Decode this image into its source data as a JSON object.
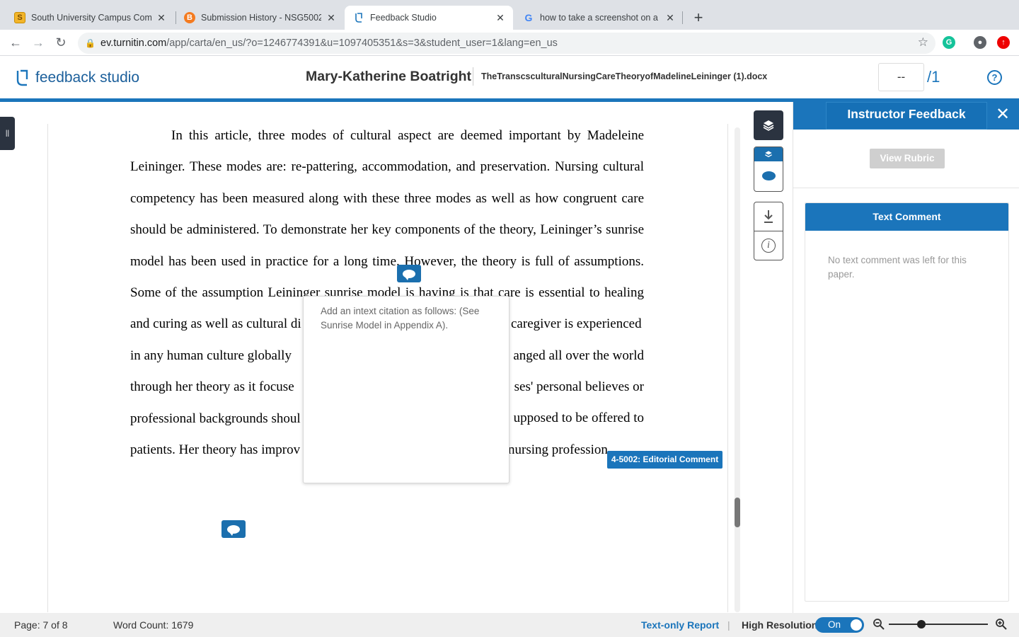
{
  "browser": {
    "tabs": [
      {
        "title": "South University Campus Com",
        "favicon": "S"
      },
      {
        "title": "Submission History - NSG5002",
        "favicon": "B"
      },
      {
        "title": "Feedback Studio",
        "favicon": ""
      },
      {
        "title": "how to take a screenshot on a",
        "favicon": "G"
      }
    ],
    "url_host": "ev.turnitin.com",
    "url_path": "/app/carta/en_us/?o=1246774391&u=1097405351&s=3&student_user=1&lang=en_us"
  },
  "header": {
    "logo_text": "feedback studio",
    "student_name": "Mary-Katherine Boatright",
    "document_name": "TheTranscsculturalNursingCareTheoryofMadelineLeininger (1).docx",
    "grade_value": "--",
    "grade_total": "/1",
    "help_label": "?"
  },
  "document": {
    "lines": [
      "In this article, three modes of cultural aspect are deemed important by Madeleine",
      "Leininger. These modes are: re-pattering, accommodation, and preservation. Nursing cultural",
      "competency has been measured along with these three modes as well as how congruent care",
      "should be administered. To demonstrate her key components of the theory, Leininger’s sunrise",
      "model has been used in practice for a long time. However, the theory is full of assumptions.",
      "Some of the assumption Leininger sunrise model is having is that care is essential to healing",
      "and curing as well as cultural di",
      "in any human culture globally",
      "through her theory as it focuse",
      "professional backgrounds shoul",
      "patients. Her theory has improv"
    ],
    "right_fragments": [
      "caregiver is experienced",
      "anged all over the world",
      "ses' personal believes or",
      "upposed to be offered to",
      "nursing profession."
    ],
    "popup_text": "Add an intext citation as follows: (See Sunrise Model in Appendix A).",
    "editorial_tag": "4-5002: Editorial Comment"
  },
  "tools": {
    "layers": "layers-icon",
    "comment_layer": "comment-icon",
    "download": "download-icon",
    "info": "i"
  },
  "panel": {
    "title": "Instructor Feedback",
    "close": "✕",
    "rubric_button": "View Rubric",
    "text_comment_title": "Text Comment",
    "text_comment_body": "No text comment was left for this paper."
  },
  "status": {
    "page": "Page: 7 of 8",
    "word_count": "Word Count: 1679",
    "text_only": "Text-only Report",
    "separator": "|",
    "high_res_label": "High Resolution",
    "toggle_state": "On",
    "zoom_level": 0.33
  },
  "colors": {
    "accent": "#1b75bb",
    "dark": "#2b3340"
  }
}
